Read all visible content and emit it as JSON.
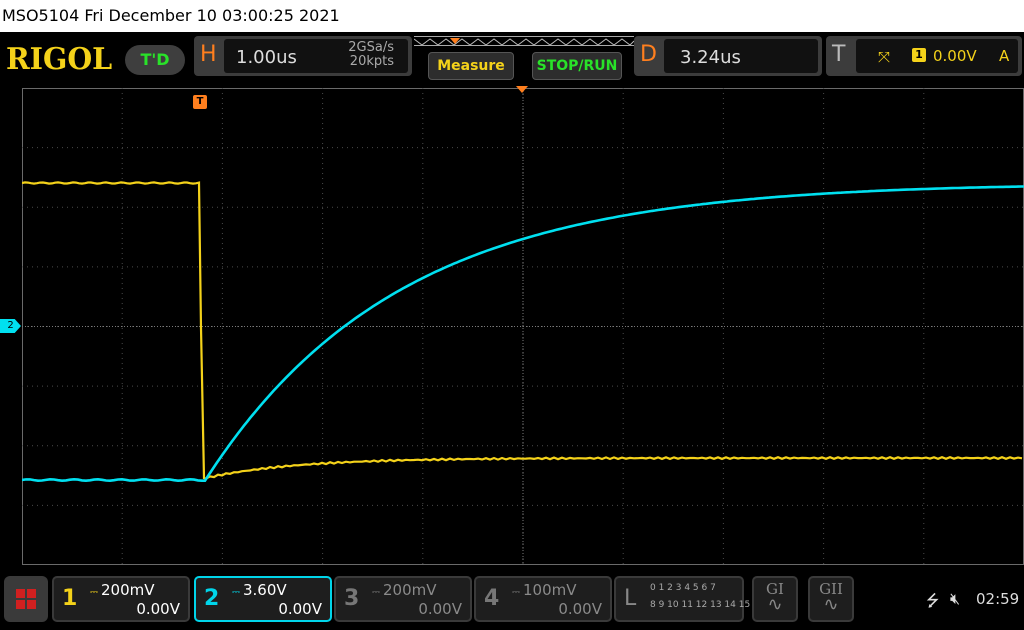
{
  "window": {
    "title": "MSO5104  Fri December 10 03:00:25 2021"
  },
  "toolbar": {
    "brand": "RIGOL",
    "run_status": "T'D",
    "horizontal": {
      "letter": "H",
      "timebase": "1.00us",
      "sample_rate": "2GSa/s",
      "memory_depth": "20kpts"
    },
    "measure_label": "Measure",
    "stop_run_label": "STOP/RUN",
    "delay": {
      "letter": "D",
      "value": "3.24us"
    },
    "trigger": {
      "letter": "T",
      "edge_icon": "falling-edge-icon",
      "source": "1",
      "level": "0.00V",
      "mode": "A"
    }
  },
  "markers": {
    "trigger_position": "T",
    "ch2_ground": "2"
  },
  "channels": [
    {
      "number": "1",
      "scale": "200mV",
      "offset": "0.00V",
      "color": "#f4d21a",
      "active": false,
      "enabled": true
    },
    {
      "number": "2",
      "scale": "3.60V",
      "offset": "0.00V",
      "color": "#00d5ea",
      "active": true,
      "enabled": true
    },
    {
      "number": "3",
      "scale": "200mV",
      "offset": "0.00V",
      "color": "#777777",
      "active": false,
      "enabled": false
    },
    {
      "number": "4",
      "scale": "100mV",
      "offset": "0.00V",
      "color": "#777777",
      "active": false,
      "enabled": false
    }
  ],
  "logic": {
    "letter": "L",
    "row1": "0 1 2 3  4 5 6 7",
    "row2": "8 9 10 11 12 13 14 15"
  },
  "generators": [
    {
      "label": "GI"
    },
    {
      "label": "GII"
    }
  ],
  "status": {
    "usb_icon": "usb-icon",
    "speaker_icon": "speaker-muted-icon",
    "time": "02:59"
  },
  "colors": {
    "ch1": "#f4d21a",
    "ch2": "#00e0f0",
    "accent": "#ff7f1e",
    "running": "#29e229"
  }
}
